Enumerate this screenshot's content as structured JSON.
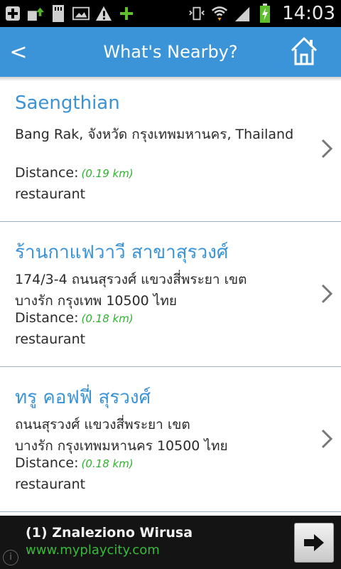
{
  "status_bar": {
    "time": "14:03",
    "icons": [
      "add-icon",
      "upload-icon",
      "sd-card-icon",
      "image-icon",
      "warning-icon",
      "plus-icon",
      "vibrate-icon",
      "wifi-icon",
      "signal-icon",
      "battery-charging-icon"
    ]
  },
  "header": {
    "back_label": "<",
    "title": "What's Nearby?",
    "home_icon": "home-icon"
  },
  "places": [
    {
      "name": "Saengthian",
      "address": "Bang Rak, จังหวัด กรุงเทพมหานคร, Thailand",
      "distance_label": "Distance:",
      "distance_value": "(0.19 km)",
      "category": "restaurant"
    },
    {
      "name": "ร้านกาแฟวาวี สาขาสุรวงศ์",
      "address": "174/3-4 ถนนสุรวงศ์ แขวงสี่พระยา เขตบางรัก กรุงเทพ 10500 ไทย",
      "distance_label": "Distance:",
      "distance_value": "(0.18 km)",
      "category": "restaurant"
    },
    {
      "name": "ทรู คอฟฟี่ สุรวงศ์",
      "address": "ถนนสุรวงศ์ แขวงสี่พระยา เขตบางรัก กรุงเทพมหานคร 10500 ไทย",
      "distance_label": "Distance:",
      "distance_value": "(0.18 km)",
      "category": "restaurant"
    }
  ],
  "ad": {
    "title": "(1) Znaleziono Wirusa",
    "url": "www.myplaycity.com",
    "info_label": "i"
  },
  "colors": {
    "header_bg": "#3a94d7",
    "place_name": "#3b93d7",
    "distance_value": "#2fb32f",
    "ad_url": "#3ab83a"
  }
}
